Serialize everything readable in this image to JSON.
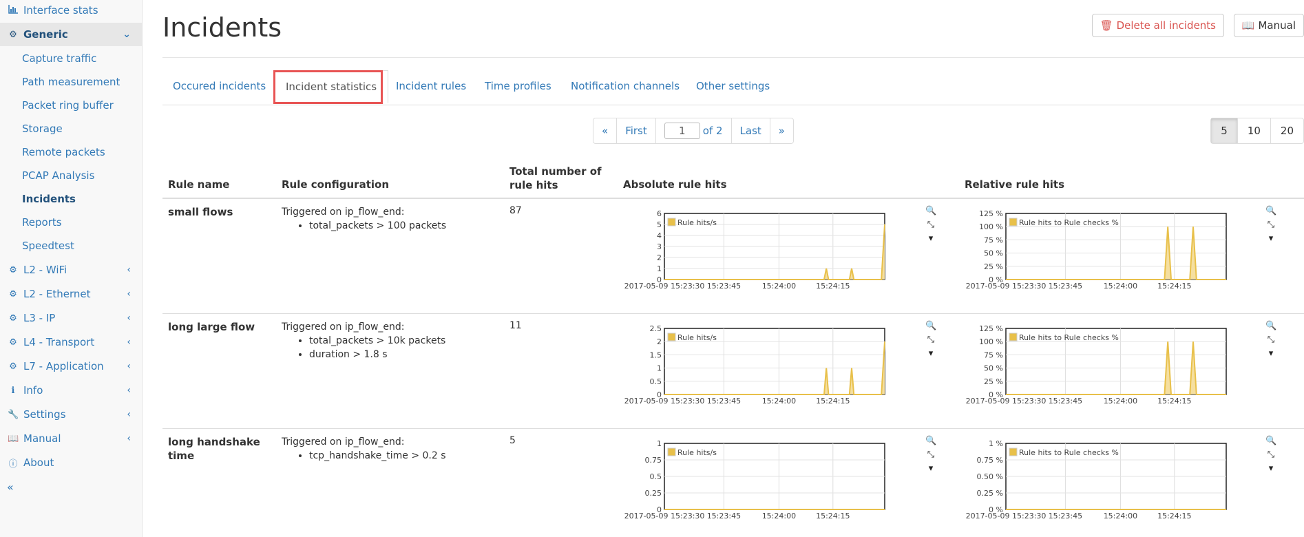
{
  "sidebar": {
    "top_item": {
      "label": "Interface stats",
      "icon": "bar-chart-icon"
    },
    "generic": {
      "label": "Generic",
      "icon": "gear-icon"
    },
    "generic_items": [
      "Capture traffic",
      "Path measurement",
      "Packet ring buffer",
      "Storage",
      "Remote packets",
      "PCAP Analysis",
      "Incidents",
      "Reports",
      "Speedtest"
    ],
    "sections": [
      {
        "label": "L2 - WiFi",
        "icon": "gear-icon"
      },
      {
        "label": "L2 - Ethernet",
        "icon": "gear-icon"
      },
      {
        "label": "L3 - IP",
        "icon": "gear-icon"
      },
      {
        "label": "L4 - Transport",
        "icon": "gear-icon"
      },
      {
        "label": "L7 - Application",
        "icon": "gear-icon"
      },
      {
        "label": "Info",
        "icon": "info-icon"
      },
      {
        "label": "Settings",
        "icon": "wrench-icon"
      },
      {
        "label": "Manual",
        "icon": "book-icon"
      }
    ],
    "about": {
      "label": "About",
      "icon": "info-circle-icon"
    },
    "collapse": "«"
  },
  "page": {
    "title": "Incidents",
    "delete_all": "Delete all incidents",
    "manual": "Manual"
  },
  "tabs": [
    "Occured incidents",
    "Incident statistics",
    "Incident rules",
    "Time profiles",
    "Notification channels",
    "Other settings"
  ],
  "pagination": {
    "prev": "«",
    "first": "First",
    "page": "1",
    "of": "of 2",
    "last": "Last",
    "next": "»",
    "sizes": [
      "5",
      "10",
      "20"
    ],
    "selected_size": "5"
  },
  "table": {
    "headers": {
      "name": "Rule name",
      "config": "Rule configuration",
      "hits": "Total number of rule hits",
      "abs": "Absolute rule hits",
      "rel": "Relative rule hits"
    },
    "rows": [
      {
        "name": "small flows",
        "trigger": "Triggered on ip_flow_end:",
        "conditions": [
          "total_packets > 100 packets"
        ],
        "hits": "87"
      },
      {
        "name": "long large flow",
        "trigger": "Triggered on ip_flow_end:",
        "conditions": [
          "total_packets > 10k packets",
          "duration > 1.8 s"
        ],
        "hits": "11"
      },
      {
        "name": "long handshake time",
        "trigger": "Triggered on ip_flow_end:",
        "conditions": [
          "tcp_handshake_time > 0.2 s"
        ],
        "hits": "5"
      }
    ]
  },
  "chart_data": [
    {
      "type": "area",
      "legend": "Rule hits/s",
      "x_ticks": [
        "2017-05-09 15:23:30",
        "15:23:45",
        "15:24:00",
        "15:24:15"
      ],
      "y_ticks": [
        "0",
        "1",
        "2",
        "3",
        "4",
        "5",
        "6"
      ],
      "ylim": [
        0,
        6
      ],
      "points": [
        [
          0,
          0
        ],
        [
          0.725,
          0
        ],
        [
          0.735,
          1
        ],
        [
          0.745,
          0
        ],
        [
          0.84,
          0
        ],
        [
          0.85,
          1
        ],
        [
          0.86,
          0
        ],
        [
          0.985,
          0
        ],
        [
          1,
          5
        ]
      ]
    },
    {
      "type": "area",
      "legend": "Rule hits to Rule checks %",
      "x_ticks": [
        "2017-05-09 15:23:30",
        "15:23:45",
        "15:24:00",
        "15:24:15"
      ],
      "y_ticks": [
        "0 %",
        "25 %",
        "50 %",
        "75 %",
        "100 %",
        "125 %"
      ],
      "ylim": [
        0,
        125
      ],
      "points": [
        [
          0,
          0
        ],
        [
          0.72,
          0
        ],
        [
          0.735,
          100
        ],
        [
          0.75,
          0
        ],
        [
          0.835,
          0
        ],
        [
          0.85,
          100
        ],
        [
          0.865,
          0
        ],
        [
          1,
          0
        ]
      ]
    },
    {
      "type": "area",
      "legend": "Rule hits/s",
      "x_ticks": [
        "2017-05-09 15:23:30",
        "15:23:45",
        "15:24:00",
        "15:24:15"
      ],
      "y_ticks": [
        "0",
        "0.5",
        "1",
        "1.5",
        "2",
        "2.5"
      ],
      "ylim": [
        0,
        2.5
      ],
      "points": [
        [
          0,
          0
        ],
        [
          0.725,
          0
        ],
        [
          0.735,
          1
        ],
        [
          0.745,
          0
        ],
        [
          0.84,
          0
        ],
        [
          0.85,
          1
        ],
        [
          0.86,
          0
        ],
        [
          0.985,
          0
        ],
        [
          1,
          2
        ]
      ]
    },
    {
      "type": "area",
      "legend": "Rule hits to Rule checks %",
      "x_ticks": [
        "2017-05-09 15:23:30",
        "15:23:45",
        "15:24:00",
        "15:24:15"
      ],
      "y_ticks": [
        "0 %",
        "25 %",
        "50 %",
        "75 %",
        "100 %",
        "125 %"
      ],
      "ylim": [
        0,
        125
      ],
      "points": [
        [
          0,
          0
        ],
        [
          0.72,
          0
        ],
        [
          0.735,
          100
        ],
        [
          0.75,
          0
        ],
        [
          0.835,
          0
        ],
        [
          0.85,
          100
        ],
        [
          0.865,
          0
        ],
        [
          1,
          0
        ]
      ]
    },
    {
      "type": "area",
      "legend": "Rule hits/s",
      "x_ticks": [
        "2017-05-09 15:23:30",
        "15:23:45",
        "15:24:00",
        "15:24:15"
      ],
      "y_ticks": [
        "0",
        "0.25",
        "0.5",
        "0.75",
        "1"
      ],
      "ylim": [
        0,
        1
      ],
      "points": [
        [
          0,
          0
        ],
        [
          1,
          0
        ]
      ]
    },
    {
      "type": "area",
      "legend": "Rule hits to Rule checks %",
      "x_ticks": [
        "2017-05-09 15:23:30",
        "15:23:45",
        "15:24:00",
        "15:24:15"
      ],
      "y_ticks": [
        "0 %",
        "0.25 %",
        "0.50 %",
        "0.75 %",
        "1 %"
      ],
      "ylim": [
        0,
        1
      ],
      "points": [
        [
          0,
          0
        ],
        [
          1,
          0
        ]
      ]
    }
  ],
  "colors": {
    "series_fill": "#f5dfa0",
    "series_line": "#e8c04a",
    "accent": "#337ab7",
    "danger": "#d9534f"
  }
}
